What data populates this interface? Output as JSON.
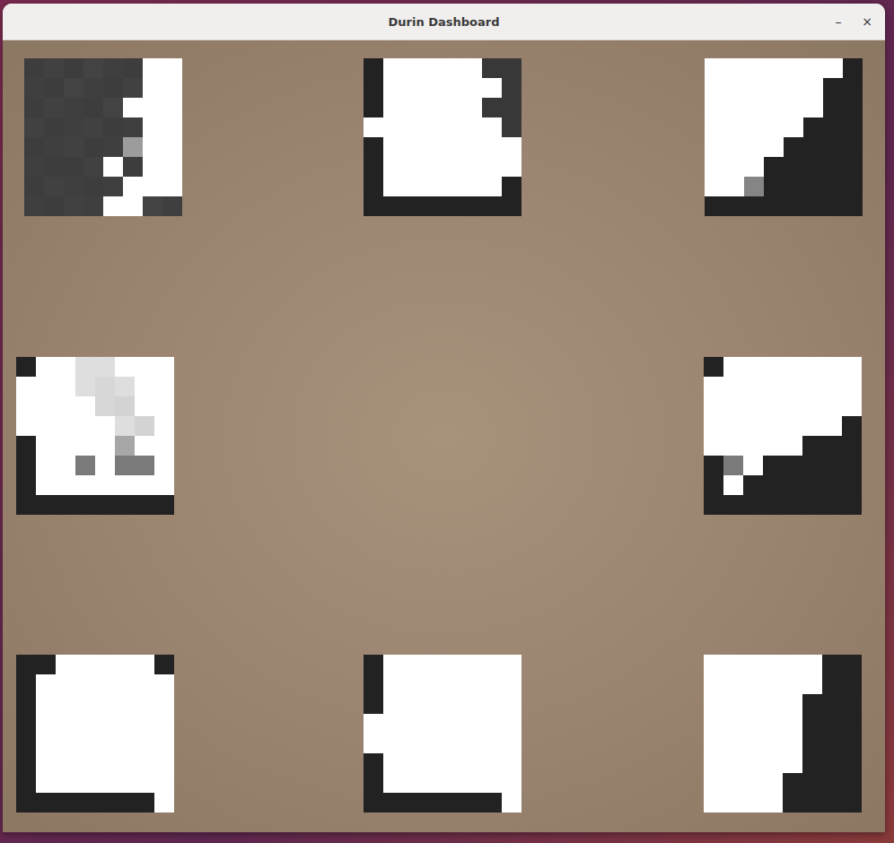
{
  "window": {
    "title": "Durin Dashboard",
    "controls": [
      "–",
      "×"
    ]
  },
  "sensors": [
    {
      "cells": [
        [
          0.12,
          0.14,
          0.12,
          0.15,
          0.13,
          0.12,
          1,
          1
        ],
        [
          0.13,
          0.12,
          0.15,
          0.13,
          0.12,
          0.14,
          1,
          1
        ],
        [
          0.12,
          0.14,
          0.13,
          0.12,
          0.15,
          1,
          1,
          1
        ],
        [
          0.14,
          0.12,
          0.13,
          0.14,
          0.12,
          0.13,
          1,
          1
        ],
        [
          0.12,
          0.13,
          0.14,
          0.12,
          0.13,
          0.55,
          1,
          1
        ],
        [
          0.13,
          0.12,
          0.12,
          0.14,
          1,
          0.12,
          1,
          1
        ],
        [
          0.12,
          0.14,
          0.13,
          0.12,
          0.13,
          1,
          1,
          1
        ],
        [
          0.13,
          0.12,
          0.14,
          0.13,
          1,
          1,
          0.15,
          0.13
        ]
      ]
    },
    {
      "cells": [
        [
          0,
          1,
          1,
          1,
          1,
          1,
          0.1,
          0.1
        ],
        [
          0,
          1,
          1,
          1,
          1,
          1,
          1,
          0.1
        ],
        [
          0,
          1,
          1,
          1,
          1,
          1,
          0.1,
          0.1
        ],
        [
          1,
          1,
          1,
          1,
          1,
          1,
          1,
          0.1
        ],
        [
          0,
          1,
          1,
          1,
          1,
          1,
          1,
          1
        ],
        [
          0,
          1,
          1,
          1,
          1,
          1,
          1,
          1
        ],
        [
          0,
          1,
          1,
          1,
          1,
          1,
          1,
          0
        ],
        [
          0,
          0,
          0,
          0,
          0,
          0,
          0,
          0
        ]
      ]
    },
    {
      "cells": [
        [
          1,
          1,
          1,
          1,
          1,
          1,
          1,
          0
        ],
        [
          1,
          1,
          1,
          1,
          1,
          1,
          0,
          0
        ],
        [
          1,
          1,
          1,
          1,
          1,
          1,
          0,
          0
        ],
        [
          1,
          1,
          1,
          1,
          1,
          0,
          0,
          0
        ],
        [
          1,
          1,
          1,
          1,
          0,
          0,
          0,
          0
        ],
        [
          1,
          1,
          1,
          0,
          0,
          0,
          0,
          0
        ],
        [
          1,
          1,
          0.45,
          0,
          0,
          0,
          0,
          0
        ],
        [
          0,
          0,
          0,
          0,
          0,
          0,
          0,
          0
        ]
      ]
    },
    {
      "cells": [
        [
          0,
          1,
          1,
          0.85,
          0.85,
          1,
          1,
          1
        ],
        [
          1,
          1,
          1,
          0.85,
          0.82,
          0.85,
          1,
          1
        ],
        [
          1,
          1,
          1,
          1,
          0.82,
          0.8,
          1,
          1
        ],
        [
          1,
          1,
          1,
          1,
          1,
          0.85,
          0.8,
          1
        ],
        [
          0,
          1,
          1,
          1,
          1,
          0.6,
          1,
          1
        ],
        [
          0,
          1,
          1,
          0.4,
          1,
          0.4,
          0.4,
          1
        ],
        [
          0,
          1,
          1,
          1,
          1,
          1,
          1,
          1
        ],
        [
          0,
          0,
          0,
          0,
          0,
          0,
          0,
          0
        ]
      ]
    },
    {
      "cells": [
        [
          0,
          1,
          1,
          1,
          1,
          1,
          1,
          1
        ],
        [
          1,
          1,
          1,
          1,
          1,
          1,
          1,
          1
        ],
        [
          1,
          1,
          1,
          1,
          1,
          1,
          1,
          1
        ],
        [
          1,
          1,
          1,
          1,
          1,
          1,
          1,
          0
        ],
        [
          1,
          1,
          1,
          1,
          1,
          0,
          0,
          0
        ],
        [
          0,
          0.4,
          1,
          0,
          0,
          0,
          0,
          0
        ],
        [
          0,
          1,
          0,
          0,
          0,
          0,
          0,
          0
        ],
        [
          0,
          0,
          0,
          0,
          0,
          0,
          0,
          0
        ]
      ]
    },
    {
      "cells": [
        [
          0,
          0,
          1,
          1,
          1,
          1,
          1,
          0
        ],
        [
          0,
          1,
          1,
          1,
          1,
          1,
          1,
          1
        ],
        [
          0,
          1,
          1,
          1,
          1,
          1,
          1,
          1
        ],
        [
          0,
          1,
          1,
          1,
          1,
          1,
          1,
          1
        ],
        [
          0,
          1,
          1,
          1,
          1,
          1,
          1,
          1
        ],
        [
          0,
          1,
          1,
          1,
          1,
          1,
          1,
          1
        ],
        [
          0,
          1,
          1,
          1,
          1,
          1,
          1,
          1
        ],
        [
          0,
          0,
          0,
          0,
          0,
          0,
          0,
          1
        ]
      ]
    },
    {
      "cells": [
        [
          0,
          1,
          1,
          1,
          1,
          1,
          1,
          1
        ],
        [
          0,
          1,
          1,
          1,
          1,
          1,
          1,
          1
        ],
        [
          0,
          1,
          1,
          1,
          1,
          1,
          1,
          1
        ],
        [
          1,
          1,
          1,
          1,
          1,
          1,
          1,
          1
        ],
        [
          1,
          1,
          1,
          1,
          1,
          1,
          1,
          1
        ],
        [
          0,
          1,
          1,
          1,
          1,
          1,
          1,
          1
        ],
        [
          0,
          1,
          1,
          1,
          1,
          1,
          1,
          1
        ],
        [
          0,
          0,
          0,
          0,
          0,
          0,
          0,
          1
        ]
      ]
    },
    {
      "cells": [
        [
          1,
          1,
          1,
          1,
          1,
          1,
          0,
          0
        ],
        [
          1,
          1,
          1,
          1,
          1,
          1,
          0,
          0
        ],
        [
          1,
          1,
          1,
          1,
          1,
          0,
          0,
          0
        ],
        [
          1,
          1,
          1,
          1,
          1,
          0,
          0,
          0
        ],
        [
          1,
          1,
          1,
          1,
          1,
          0,
          0,
          0
        ],
        [
          1,
          1,
          1,
          1,
          1,
          0,
          0,
          0
        ],
        [
          1,
          1,
          1,
          1,
          0,
          0,
          0,
          0
        ],
        [
          1,
          1,
          1,
          1,
          0,
          0,
          0,
          0
        ]
      ]
    }
  ]
}
